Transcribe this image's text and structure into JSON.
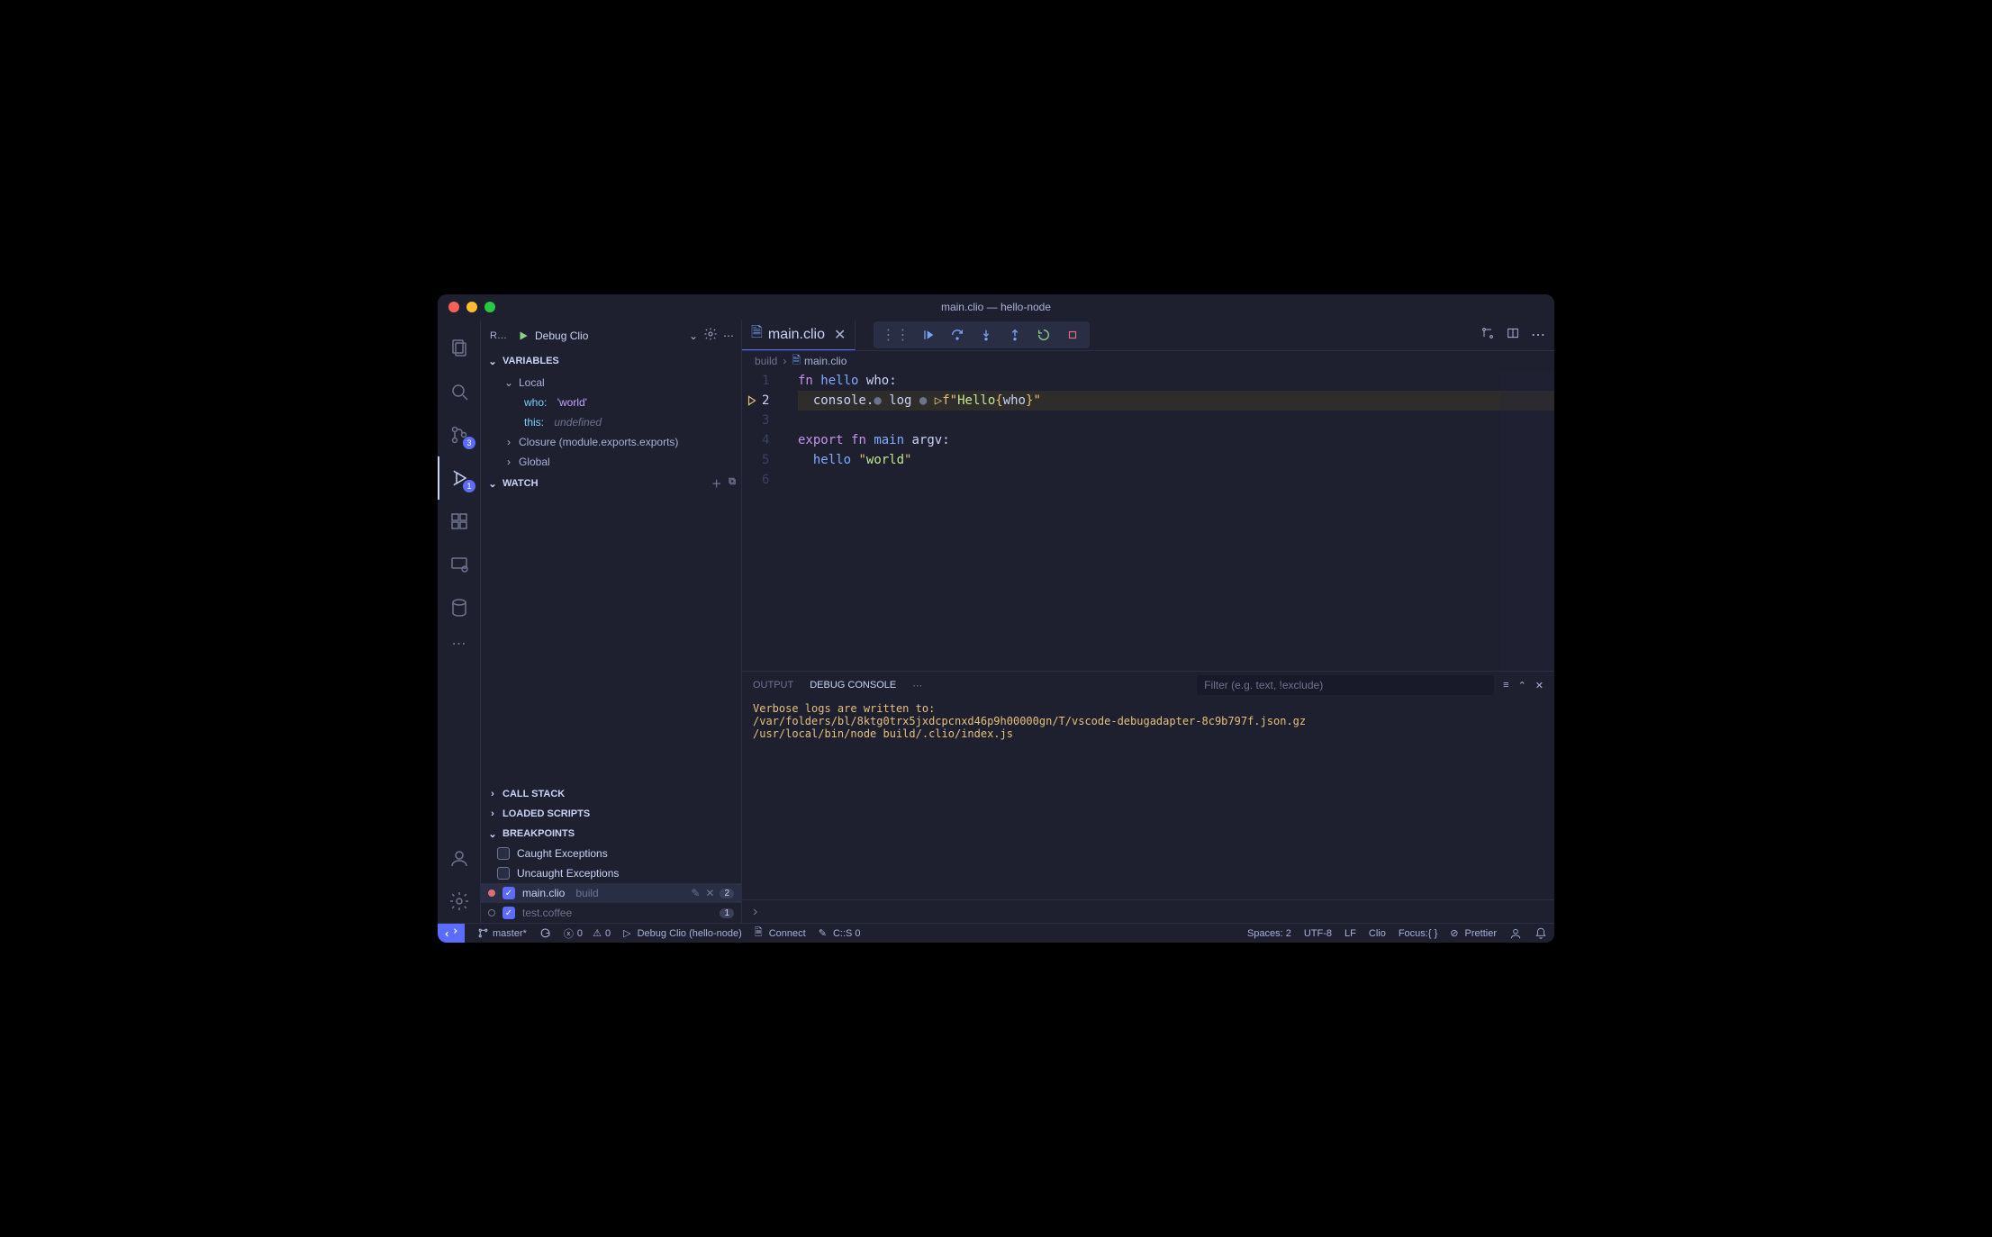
{
  "title": "main.clio — hello-node",
  "activitybar": {
    "scm_badge": "3",
    "debug_badge": "1"
  },
  "sidebar": {
    "run_short": "R…",
    "config": "Debug Clio",
    "sections": {
      "variables": "Variables",
      "watch": "Watch",
      "callstack": "Call Stack",
      "loaded": "Loaded Scripts",
      "breakpoints": "Breakpoints"
    },
    "vars": {
      "local": "Local",
      "who_name": "who:",
      "who_val": "'world'",
      "this_name": "this:",
      "this_val": "undefined",
      "closure": "Closure (module.exports.exports)",
      "global": "Global"
    },
    "bp": {
      "caught": "Caught Exceptions",
      "uncaught": "Uncaught Exceptions",
      "file1": "main.clio",
      "file1_meta": "build",
      "file1_count": "2",
      "file2": "test.coffee",
      "file2_count": "1"
    }
  },
  "tabs": {
    "main": "main.clio"
  },
  "breadcrumb": {
    "seg1": "build",
    "seg2": "main.clio"
  },
  "editor": {
    "l1": {
      "kw1": "fn",
      "fn": "hello",
      "id": "who",
      "colon": ":"
    },
    "l2": {
      "obj": "console",
      "dot1": ".",
      "bullet1": "●",
      "meth": "log",
      "bullet2": "●",
      "f": "f",
      "q1": "\"",
      "str1": "Hello ",
      "lb": "{",
      "inter": "who",
      "rb": "}",
      "q2": "\""
    },
    "l4": {
      "kw1": "export",
      "kw2": "fn",
      "fn": "main",
      "id": "argv",
      "colon": ":"
    },
    "l5": {
      "fn": "hello",
      "q1": "\"",
      "str": "world",
      "q2": "\""
    }
  },
  "panel": {
    "tabs": {
      "output": "Output",
      "debug": "Debug Console"
    },
    "filter_placeholder": "Filter (e.g. text, !exclude)",
    "lines": [
      "Verbose logs are written to:",
      "/var/folders/bl/8ktg0trx5jxdcpcnxd46p9h00000gn/T/vscode-debugadapter-8c9b797f.json.gz",
      "/usr/local/bin/node build/.clio/index.js"
    ]
  },
  "status": {
    "branch": "master*",
    "errors": "0",
    "warnings": "0",
    "debug": "Debug Clio (hello-node)",
    "connect": "Connect",
    "cs": "C::S 0",
    "spaces": "Spaces: 2",
    "encoding": "UTF-8",
    "eol": "LF",
    "lang": "Clio",
    "focus": "Focus:{ }",
    "prettier": "Prettier"
  }
}
